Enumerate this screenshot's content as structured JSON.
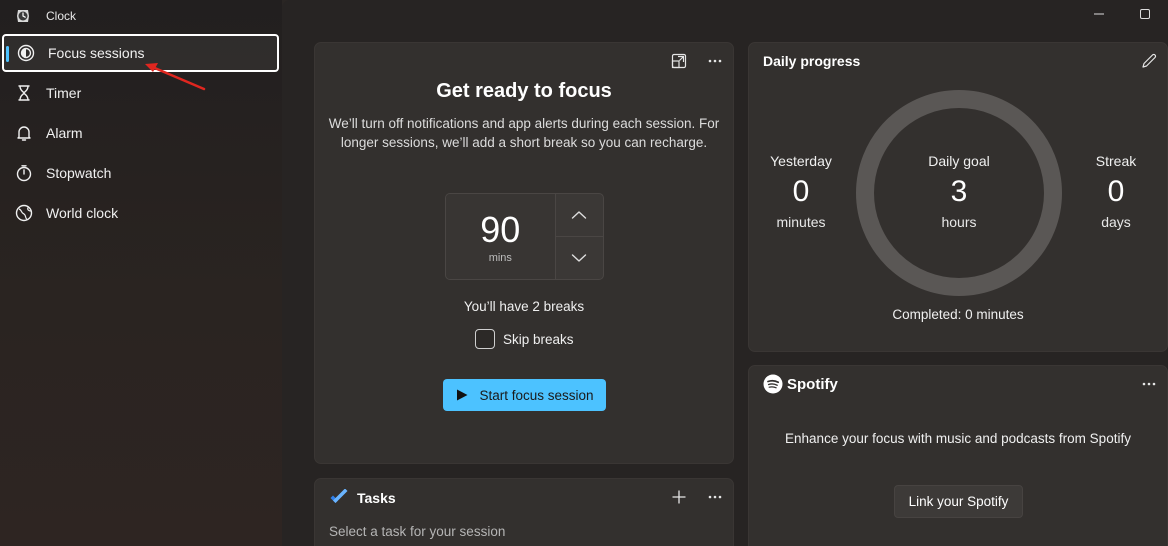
{
  "app": {
    "title": "Clock"
  },
  "sidebar": {
    "items": [
      {
        "label": "Focus sessions",
        "icon": "focus-icon",
        "active": true
      },
      {
        "label": "Timer",
        "icon": "hourglass-icon"
      },
      {
        "label": "Alarm",
        "icon": "bell-icon"
      },
      {
        "label": "Stopwatch",
        "icon": "stopwatch-icon"
      },
      {
        "label": "World clock",
        "icon": "globe-icon"
      }
    ]
  },
  "window_controls": {
    "minimize": "—",
    "maximize": "☐"
  },
  "focus": {
    "title": "Get ready to focus",
    "description": "We’ll turn off notifications and app alerts during each session. For longer sessions, we’ll add a short break so you can recharge.",
    "minutes_value": "90",
    "minutes_unit": "mins",
    "breaks_text": "You’ll have 2 breaks",
    "skip_breaks_label": "Skip breaks",
    "skip_breaks_checked": false,
    "start_label": "Start focus session"
  },
  "daily_progress": {
    "title": "Daily progress",
    "yesterday": {
      "label": "Yesterday",
      "value": "0",
      "unit": "minutes"
    },
    "goal": {
      "label": "Daily goal",
      "value": "3",
      "unit": "hours"
    },
    "streak": {
      "label": "Streak",
      "value": "0",
      "unit": "days"
    },
    "completed_text": "Completed: 0 minutes",
    "progress_fraction": 0
  },
  "spotify": {
    "brand": "Spotify",
    "text": "Enhance your focus with music and podcasts from Spotify",
    "link_label": "Link your Spotify"
  },
  "tasks": {
    "title": "Tasks",
    "placeholder": "Select a task for your session"
  },
  "colors": {
    "accent": "#4cc2ff",
    "annotation_arrow": "#e0261f",
    "ring": "#5a5755"
  }
}
